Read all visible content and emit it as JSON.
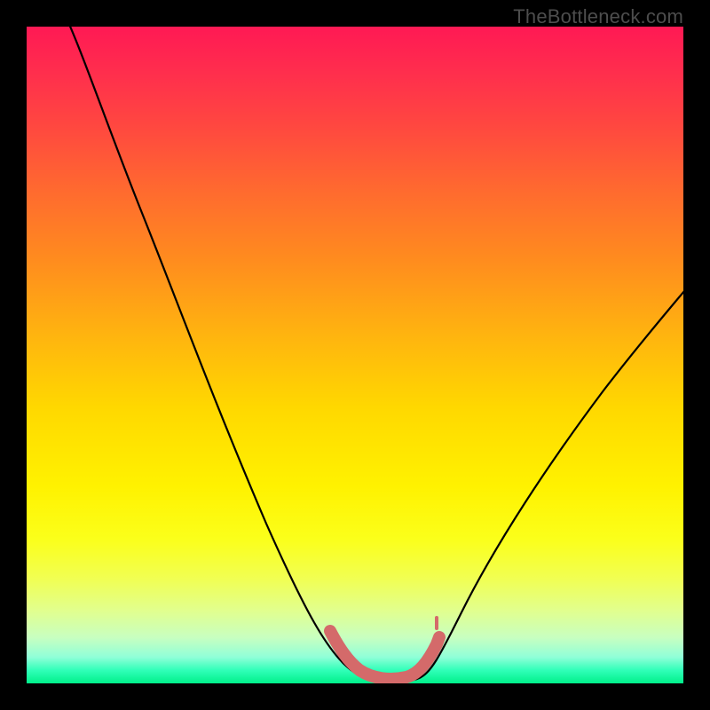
{
  "watermark": {
    "text": "TheBottleneck.com"
  },
  "chart_data": {
    "type": "line",
    "title": "",
    "xlabel": "",
    "ylabel": "",
    "xlim": [
      0,
      100
    ],
    "ylim": [
      0,
      100
    ],
    "grid": false,
    "legend": false,
    "background_gradient": {
      "direction": "vertical",
      "stops": [
        {
          "pos": 0.0,
          "color": "#ff1954"
        },
        {
          "pos": 0.5,
          "color": "#ffd800"
        },
        {
          "pos": 0.8,
          "color": "#fbff1a"
        },
        {
          "pos": 1.0,
          "color": "#00f08a"
        }
      ]
    },
    "series": [
      {
        "name": "bottleneck-curve",
        "color": "#000000",
        "x": [
          0,
          5,
          10,
          15,
          20,
          25,
          30,
          35,
          40,
          45,
          48,
          50,
          52,
          55,
          58,
          60,
          65,
          70,
          75,
          80,
          85,
          90,
          95,
          100
        ],
        "y": [
          105,
          101,
          94,
          86,
          77,
          66,
          55,
          44,
          32,
          18,
          9,
          3,
          0.5,
          0,
          0.5,
          3,
          12,
          22,
          31,
          39,
          46,
          52,
          58,
          63
        ]
      },
      {
        "name": "optimal-zone-marker",
        "color": "#d46a6a",
        "x": [
          46,
          48,
          50,
          52,
          54,
          56,
          58,
          60,
          61
        ],
        "y": [
          10,
          5,
          2,
          0.5,
          0,
          0.5,
          1,
          3,
          6
        ]
      }
    ]
  }
}
